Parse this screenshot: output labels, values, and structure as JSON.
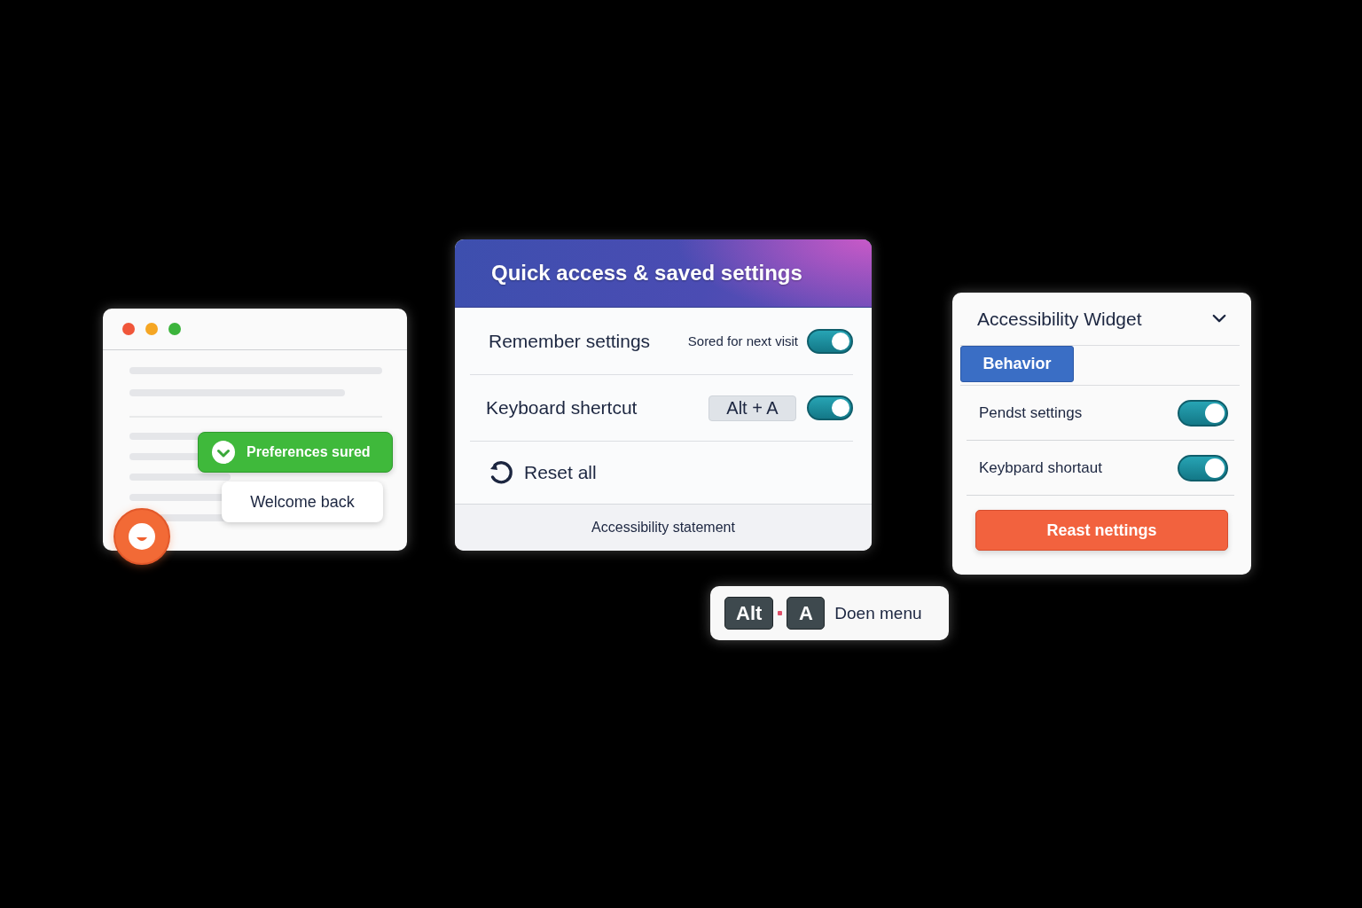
{
  "browser_window": {
    "window_controls": [
      {
        "color": "#f0563a"
      },
      {
        "color": "#f5a623"
      },
      {
        "color": "#3cb43c"
      }
    ],
    "toast": {
      "text": "Preferences sured"
    },
    "welcome_card": {
      "text": "Welcome back"
    }
  },
  "quick_panel": {
    "title": "Quick access & saved settings",
    "rows": [
      {
        "kind": "toggle",
        "label": "Remember settings",
        "note": "Sored for next visit",
        "on": true
      },
      {
        "kind": "shortcut",
        "label": "Keyboard shertcut",
        "key": "Alt + A",
        "on": true
      },
      {
        "kind": "action",
        "label": "Reset all"
      }
    ],
    "footer_link": "Accessibility statement"
  },
  "widget": {
    "title": "Accessibility Widget",
    "tabs": [
      {
        "label": "Behavior",
        "selected": true
      }
    ],
    "settings": [
      {
        "label": "Pendst settings",
        "on": true
      },
      {
        "label": "Keybpard shortaut",
        "on": true
      }
    ],
    "reset_button": "Reast nettings"
  },
  "shortcut_hint": {
    "keys": [
      "Alt",
      "A"
    ],
    "label": "Doen menu"
  }
}
